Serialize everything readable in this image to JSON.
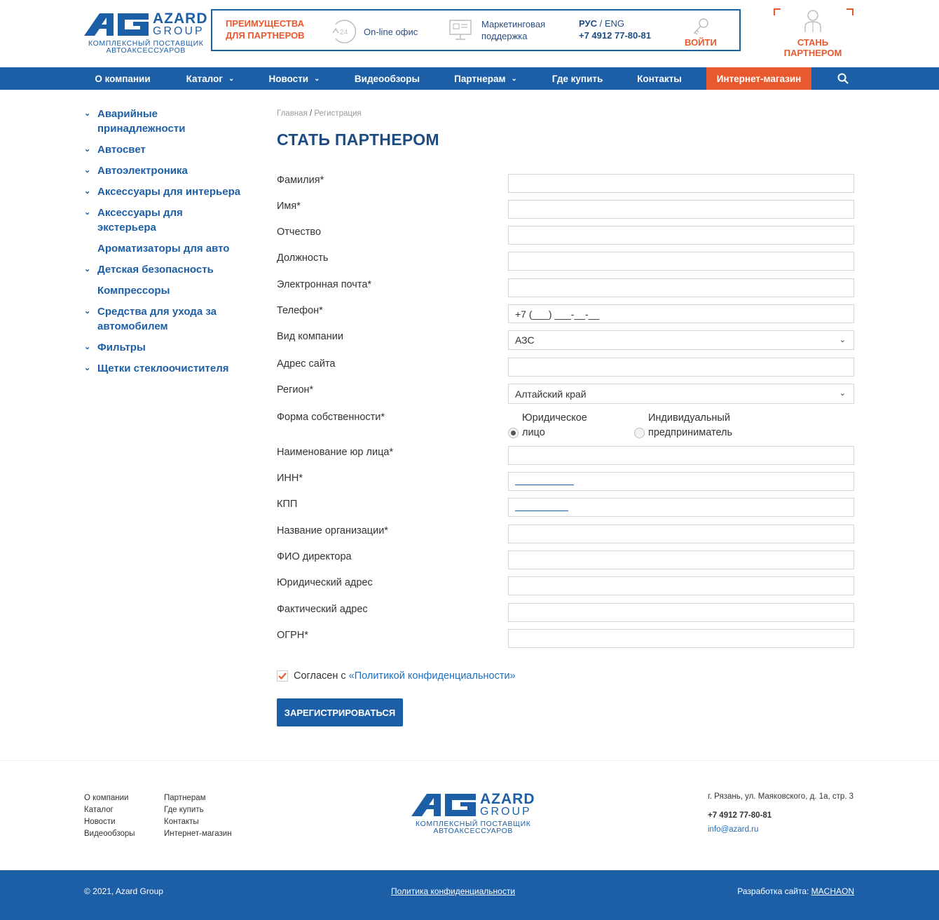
{
  "header": {
    "logo": {
      "name_line1": "AZARD",
      "name_line2": "GROUP",
      "tagline1": "КОМПЛЕКСНЫЙ ПОСТАВЩИК",
      "tagline2": "АВТОАКСЕССУАРОВ"
    },
    "advantages_line1": "ПРЕИМУЩЕСТВА",
    "advantages_line2": "ДЛЯ ПАРТНЕРОВ",
    "online_badge": "24",
    "online_label": "On-line офис",
    "marketing_line1": "Маркетинговая",
    "marketing_line2": "поддержка",
    "lang_ru": "РУС",
    "lang_sep": " / ",
    "lang_en": "ENG",
    "phone": "+7 4912 77-80-81",
    "login": "ВОЙТИ",
    "become_partner": "СТАНЬ ПАРТНЕРОМ"
  },
  "nav": {
    "items": [
      {
        "label": "О компании"
      },
      {
        "label": "Каталог"
      },
      {
        "label": "Новости"
      },
      {
        "label": "Видеообзоры"
      },
      {
        "label": "Партнерам"
      },
      {
        "label": "Где купить"
      },
      {
        "label": "Контакты"
      },
      {
        "label": "Интернет-магазин"
      }
    ]
  },
  "sidebar": {
    "items": [
      {
        "line1": "Аварийные",
        "line2": "принадлежности"
      },
      {
        "line1": "Автосвет"
      },
      {
        "line1": "Автоэлектроника"
      },
      {
        "line1": "Аксессуары для интерьера"
      },
      {
        "line1": "Аксессуары для",
        "line2": "экстерьера"
      },
      {
        "line1": "Ароматизаторы для авто"
      },
      {
        "line1": "Детская безопасность"
      },
      {
        "line1": "Компрессоры"
      },
      {
        "line1": "Средства для ухода за",
        "line2": "автомобилем"
      },
      {
        "line1": "Фильтры"
      },
      {
        "line1": "Щетки стеклоочистителя"
      }
    ]
  },
  "breadcrumb": {
    "home": "Главная",
    "sep": " / ",
    "current": "Регистрация"
  },
  "page_title": "СТАТЬ ПАРТНЕРОМ",
  "form": {
    "surname": {
      "label": "Фамилия*",
      "value": ""
    },
    "name": {
      "label": "Имя*",
      "value": ""
    },
    "patronymic": {
      "label": "Отчество",
      "value": ""
    },
    "position": {
      "label": "Должность",
      "value": ""
    },
    "email": {
      "label": "Электронная почта*",
      "value": ""
    },
    "phone": {
      "label": "Телефон*",
      "value": "+7 (___) ___-__-__"
    },
    "company_type": {
      "label": "Вид компании",
      "value": "АЗС"
    },
    "site": {
      "label": "Адрес сайта",
      "value": ""
    },
    "region": {
      "label": "Регион*",
      "value": "Алтайский край"
    },
    "ownership": {
      "label": "Форма собственности*",
      "opt1_line1": "Юридическое",
      "opt1_line2": "лицо",
      "opt2_line1": "Индивидуальный",
      "opt2_line2": "предприниматель",
      "selected": "Юридическое лицо"
    },
    "legal_name": {
      "label": "Наименование юр лица*",
      "value": ""
    },
    "inn": {
      "label": "ИНН*",
      "value": ""
    },
    "kpp": {
      "label": "КПП",
      "value": ""
    },
    "org_name": {
      "label": "Название организации*",
      "value": ""
    },
    "director": {
      "label": "ФИО директора",
      "value": ""
    },
    "legal_address": {
      "label": "Юридический адрес",
      "value": ""
    },
    "actual_address": {
      "label": "Фактический адрес",
      "value": ""
    },
    "ogrn": {
      "label": "ОГРН*",
      "value": ""
    },
    "agree_text": "Согласен с",
    "agree_link": "«Политикой конфиденциальности»",
    "agree_checked": true,
    "submit": "ЗАРЕГИСТРИРОВАТЬСЯ"
  },
  "footer": {
    "col1": [
      "О компании",
      "Каталог",
      "Новости",
      "Видеообзоры"
    ],
    "col2": [
      "Партнерам",
      "Где купить",
      "Контакты",
      "Интернет-магазин"
    ],
    "address": "г. Рязань, ул. Маяковского, д. 1а, стр. 3",
    "phone": "+7 4912 77-80-81",
    "email": "info@azard.ru",
    "copyright": "© 2021, Azard Group",
    "policy": "Политика конфиденциальности",
    "dev_label": "Разработка сайта: ",
    "dev_name": "MACHAON"
  },
  "colors": {
    "primary": "#1d5fa6",
    "accent": "#e8592e"
  }
}
